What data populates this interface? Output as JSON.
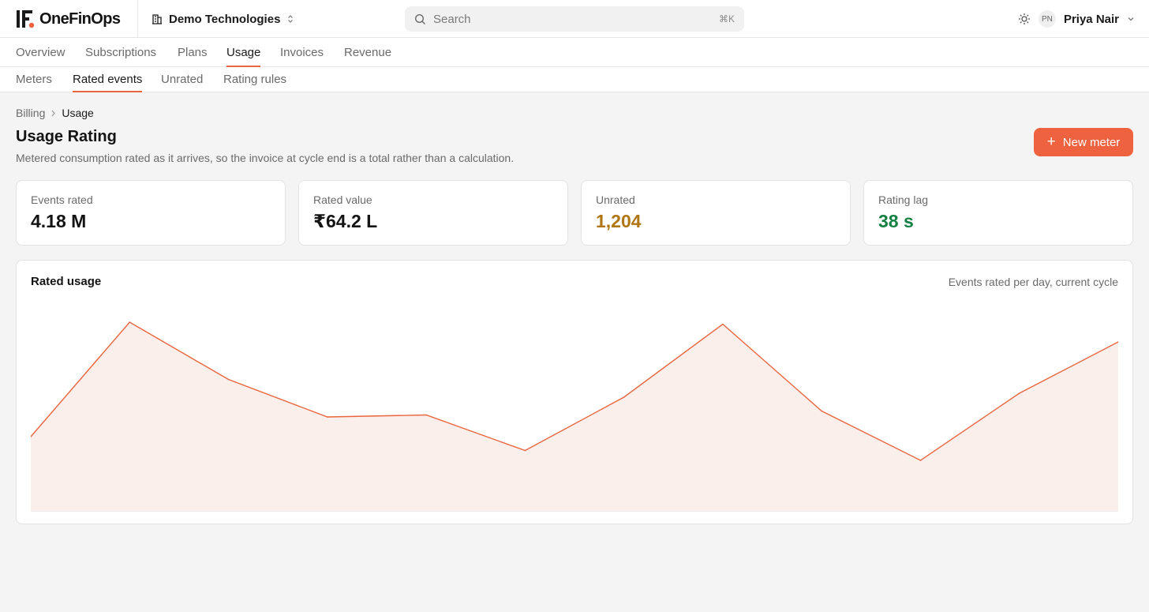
{
  "brand": {
    "name": "OneFinOps",
    "accent": "#ef6240"
  },
  "org": {
    "name": "Demo Technologies"
  },
  "search": {
    "placeholder": "Search",
    "shortcut": "⌘K"
  },
  "user": {
    "initials": "PN",
    "name": "Priya Nair"
  },
  "nav": {
    "tabs": [
      {
        "label": "Overview"
      },
      {
        "label": "Subscriptions"
      },
      {
        "label": "Plans"
      },
      {
        "label": "Usage"
      },
      {
        "label": "Invoices"
      },
      {
        "label": "Revenue"
      }
    ],
    "active": "Usage"
  },
  "subnav": {
    "tabs": [
      {
        "label": "Meters"
      },
      {
        "label": "Rated events"
      },
      {
        "label": "Unrated"
      },
      {
        "label": "Rating rules"
      }
    ],
    "active": "Rated events"
  },
  "breadcrumb": {
    "parent": "Billing",
    "current": "Usage"
  },
  "page": {
    "title": "Usage Rating",
    "subtitle": "Metered consumption rated as it arrives, so the invoice at cycle end is a total rather than a calculation.",
    "new_button": "New meter"
  },
  "stats": [
    {
      "label": "Events rated",
      "value": "4.18 M",
      "color": "#141414"
    },
    {
      "label": "Rated value",
      "value": "₹64.2 L",
      "color": "#141414"
    },
    {
      "label": "Unrated",
      "value": "1,204",
      "color": "#b07514"
    },
    {
      "label": "Rating lag",
      "value": "38 s",
      "color": "#178043"
    }
  ],
  "panel": {
    "title": "Rated usage",
    "caption": "Events rated per day, current cycle"
  },
  "chart_data": {
    "type": "area",
    "title": "",
    "xlabel": "",
    "ylabel": "",
    "grid": false,
    "legend": "none",
    "x": [
      1,
      2,
      3,
      4,
      5,
      6,
      7,
      8,
      9,
      10,
      11,
      12
    ],
    "values": [
      38,
      96,
      67,
      48,
      49,
      31,
      58,
      95,
      51,
      26,
      60,
      86
    ],
    "ylim": [
      0,
      100
    ],
    "line_color": "#e8653e",
    "fill_color": "#fbefeb"
  }
}
